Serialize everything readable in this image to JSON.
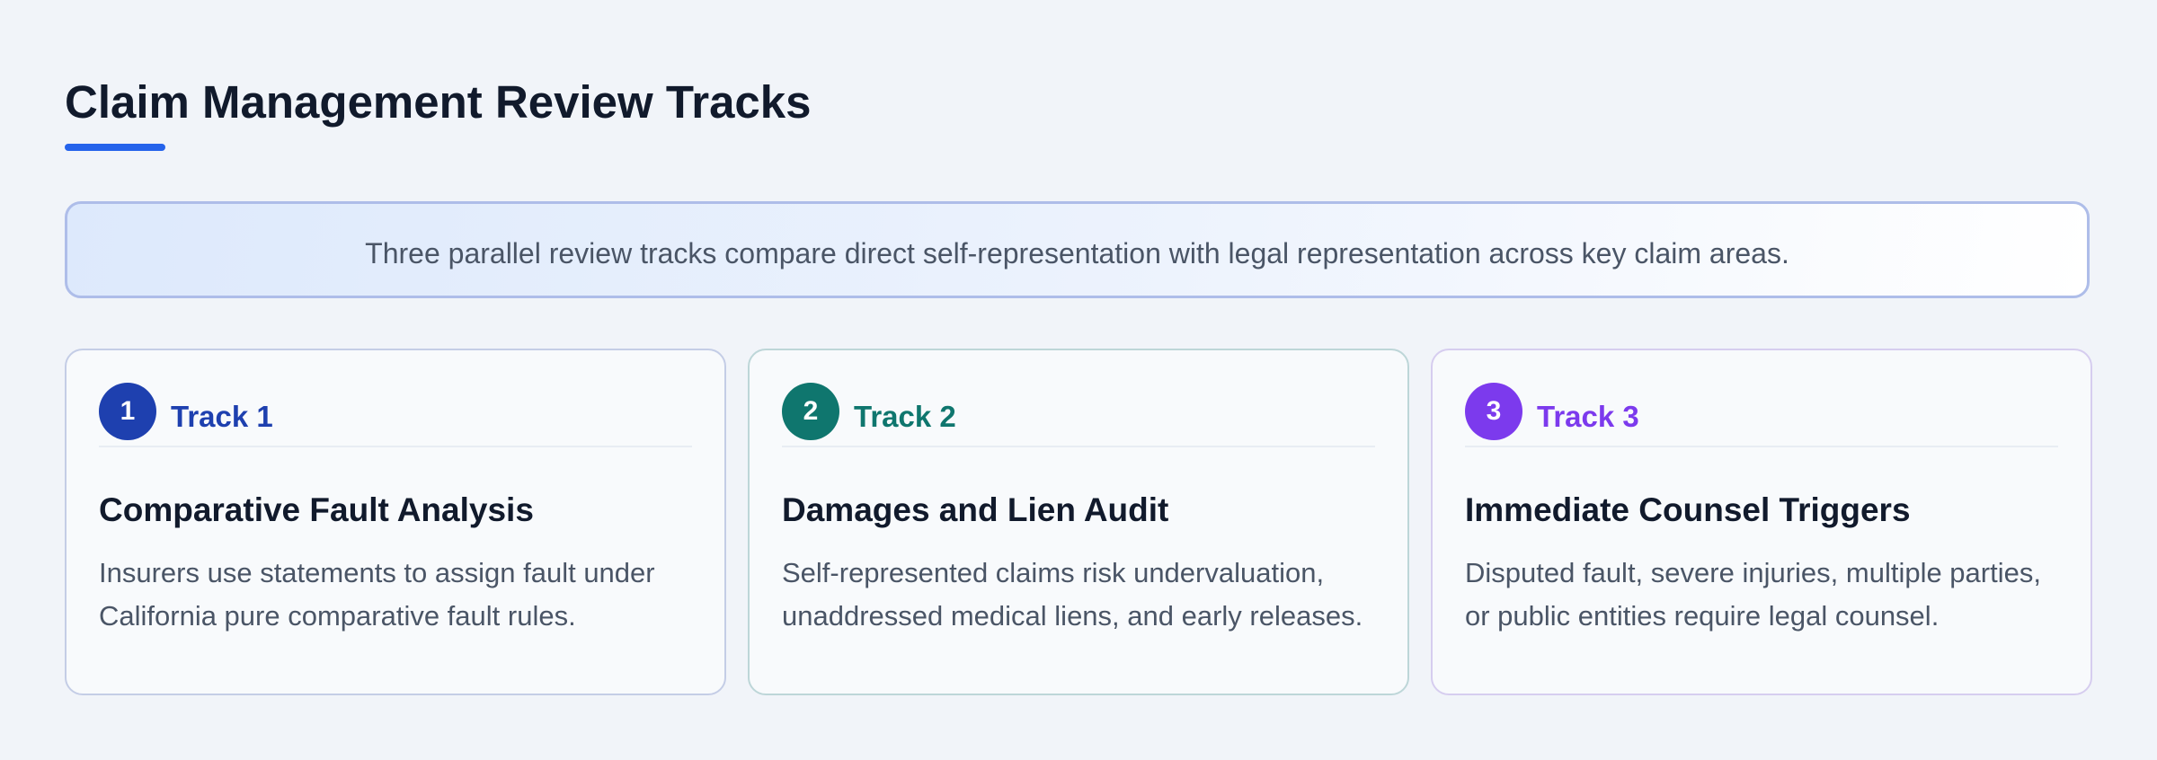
{
  "page": {
    "title": "Claim Management Review Tracks",
    "accent_color": "#2563eb"
  },
  "summary": {
    "text": "Three parallel review tracks compare direct self-representation with legal representation across key claim areas."
  },
  "tracks": [
    {
      "number": "1",
      "label": "Track 1",
      "title": "Comparative Fault Analysis",
      "description": "Insurers use statements to assign fault under California pure comparative fault rules.",
      "color": "#1e40af"
    },
    {
      "number": "2",
      "label": "Track 2",
      "title": "Damages and Lien Audit",
      "description": "Self-represented claims risk undervaluation, unaddressed medical liens, and early releases.",
      "color": "#0f766e"
    },
    {
      "number": "3",
      "label": "Track 3",
      "title": "Immediate Counsel Triggers",
      "description": "Disputed fault, severe injuries, multiple parties, or public entities require legal counsel.",
      "color": "#7c3aed"
    }
  ]
}
